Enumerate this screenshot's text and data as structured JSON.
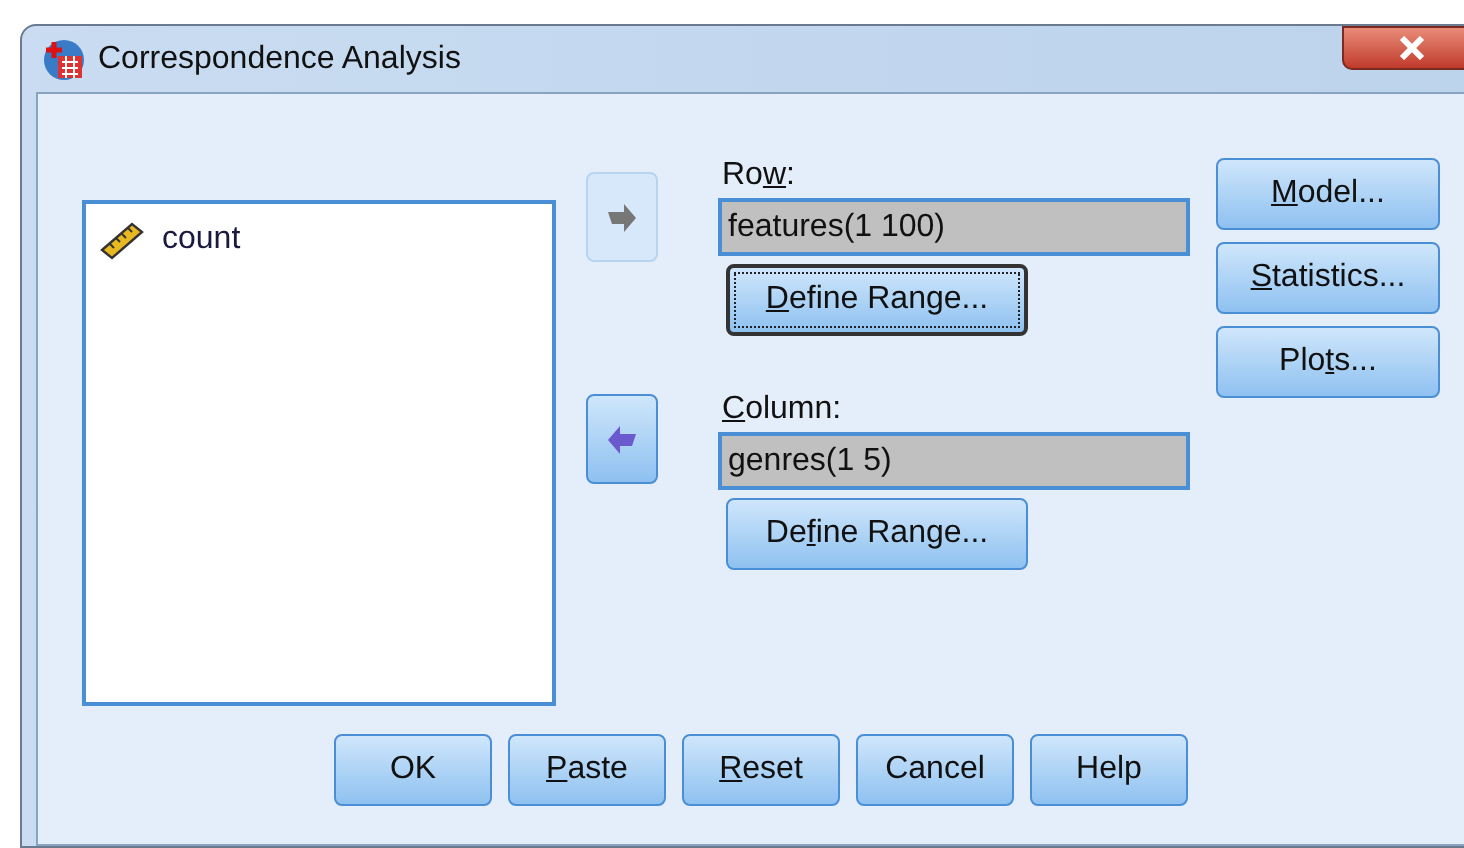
{
  "window": {
    "title": "Correspondence Analysis"
  },
  "variables": [
    {
      "name": "count"
    }
  ],
  "arrows": [
    {
      "kind": "right",
      "disabled": true
    },
    {
      "kind": "left",
      "disabled": false
    }
  ],
  "row": {
    "label": {
      "pre": "Ro",
      "key": "w",
      "post": ":"
    },
    "value": "features(1 100)",
    "button": {
      "key": "D",
      "post": "efine Range...",
      "focused": true
    }
  },
  "column": {
    "label": {
      "key": "C",
      "post": "olumn:"
    },
    "value": "genres(1 5)",
    "button": {
      "pre": "De",
      "key": "f",
      "post": "ine Range...",
      "focused": false
    }
  },
  "side_buttons": [
    {
      "key": "M",
      "post": "odel..."
    },
    {
      "key": "S",
      "post": "tatistics..."
    },
    {
      "pre": "Plo",
      "key": "t",
      "post": "s..."
    }
  ],
  "bottom_buttons": [
    {
      "pre": "OK"
    },
    {
      "key": "P",
      "post": "aste"
    },
    {
      "key": "R",
      "post": "eset"
    },
    {
      "pre": "Cancel"
    },
    {
      "pre": "Help"
    }
  ]
}
